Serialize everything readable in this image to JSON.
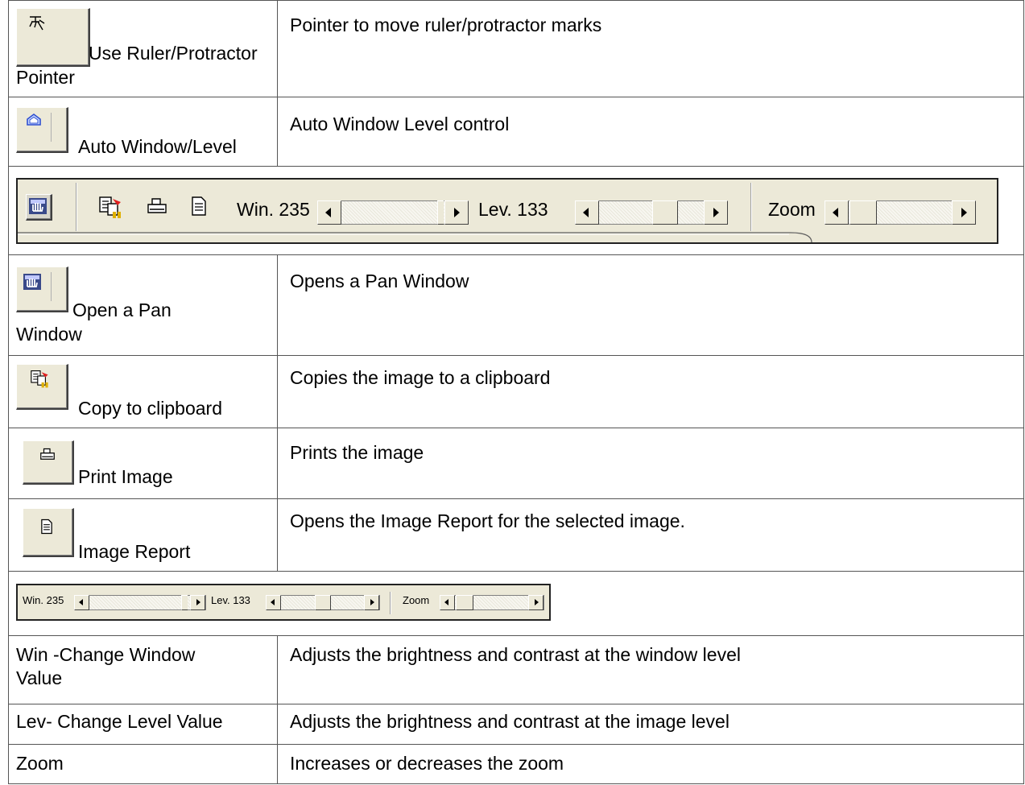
{
  "rows": [
    {
      "label": "Use Ruler/Protractor Pointer",
      "label_line1": "Use Ruler/Protractor",
      "label_line2": "Pointer",
      "desc": "Pointer to move ruler/protractor marks",
      "icon": "ruler-pointer-icon"
    },
    {
      "label": "Auto Window/Level",
      "desc": "Auto Window Level control",
      "icon": "auto-window-level-icon"
    },
    {
      "label_line1": "Open a Pan",
      "label_line2": "Window",
      "desc": "Opens a Pan Window",
      "icon": "pan-hand-icon"
    },
    {
      "label": "Copy to clipboard",
      "desc": "Copies the image to a clipboard",
      "icon": "copy-clipboard-icon"
    },
    {
      "label": "Print Image",
      "desc": "Prints the image",
      "icon": "printer-icon"
    },
    {
      "label": "Image Report",
      "desc": "Opens the Image Report for the selected image.",
      "icon": "report-document-icon"
    },
    {
      "label_line1": "Win -Change Window",
      "label_line2": "Value",
      "desc": "Adjusts the brightness and contrast at the window level"
    },
    {
      "label": "Lev- Change Level Value",
      "desc": "Adjusts the brightness and contrast at the image level"
    },
    {
      "label": "Zoom",
      "desc": "Increases or decreases the zoom"
    }
  ],
  "toolbar": {
    "win_label": "Win. 235",
    "lev_label": "Lev. 133",
    "zoom_label": "Zoom",
    "win_value": 235,
    "lev_value": 133
  }
}
